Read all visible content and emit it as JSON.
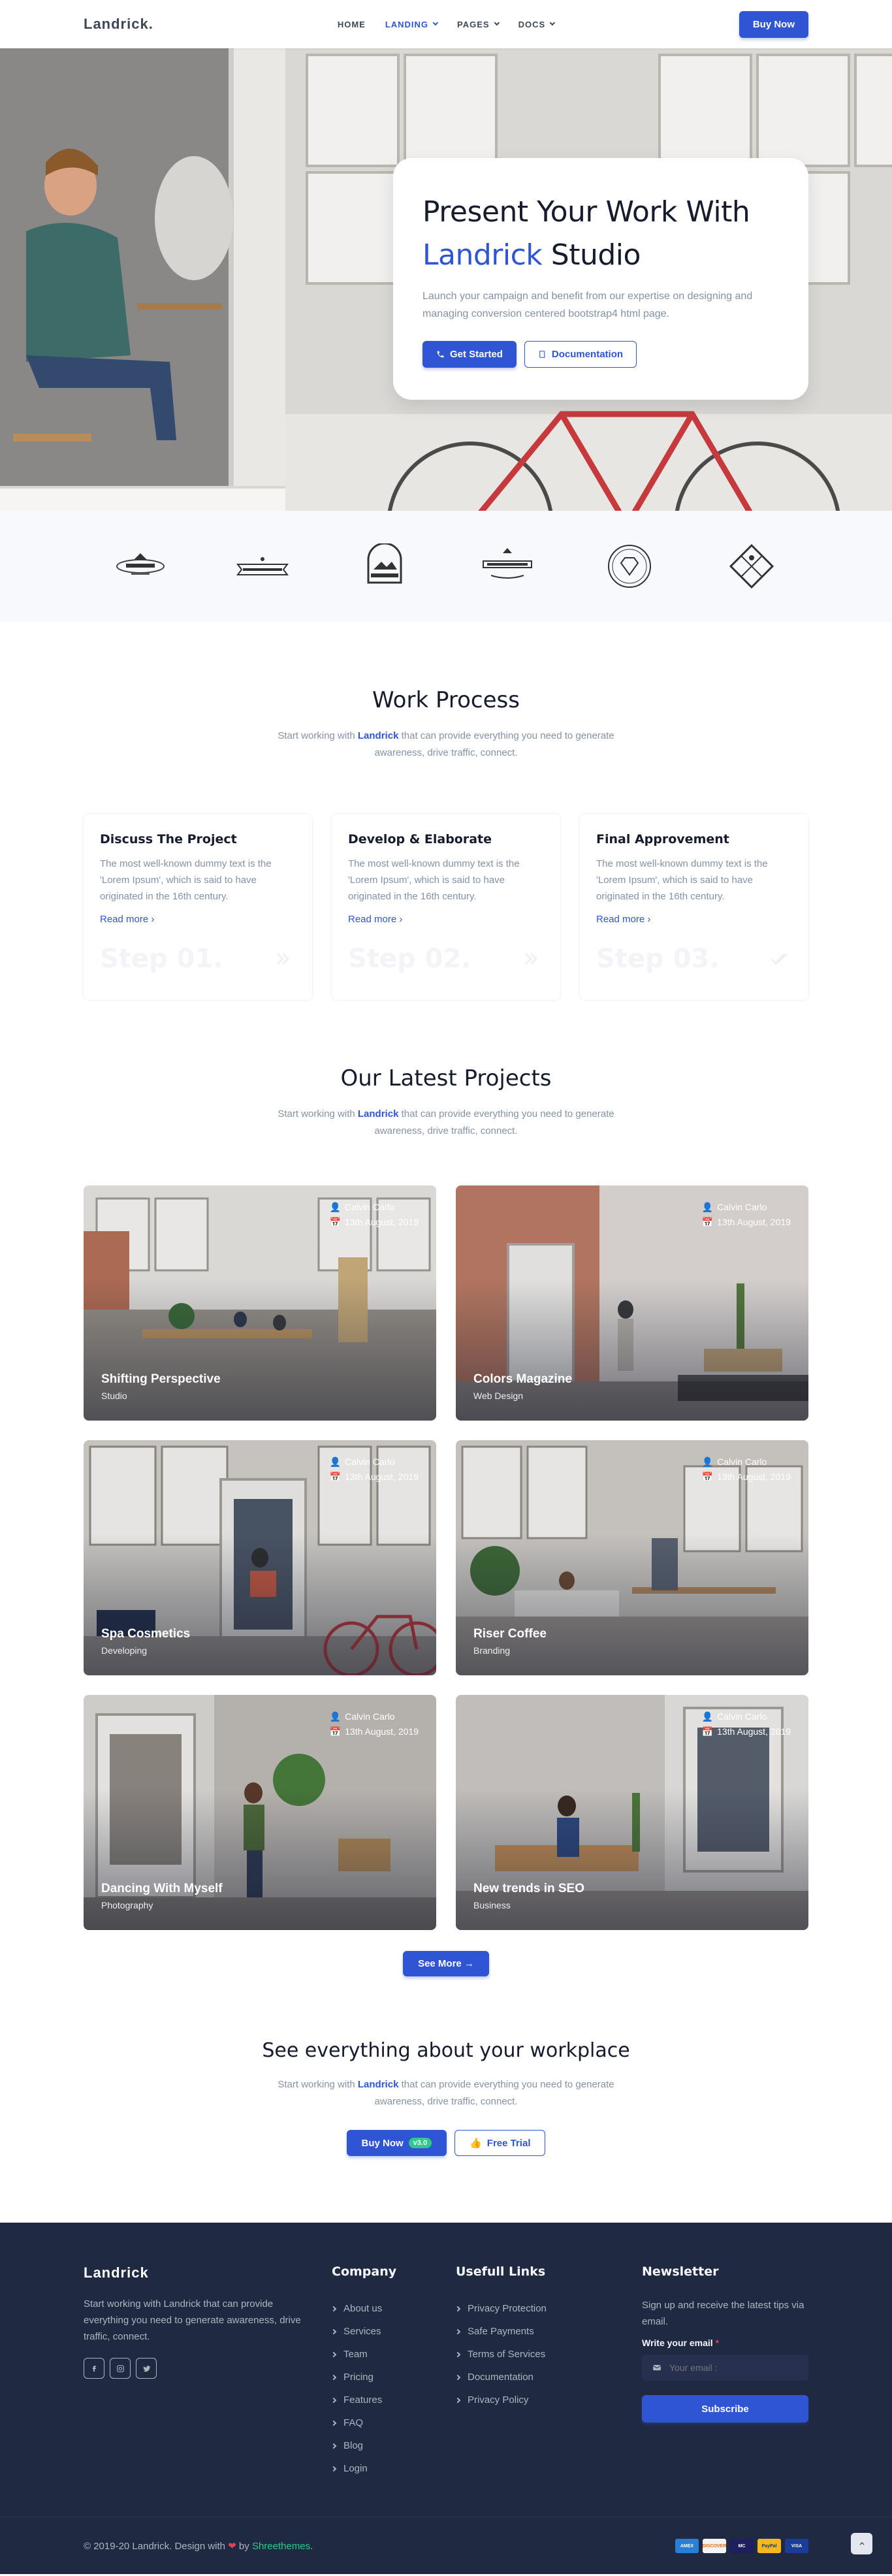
{
  "nav": {
    "logo": "Landrick.",
    "items": [
      {
        "label": "HOME",
        "dropdown": false
      },
      {
        "label": "LANDING",
        "dropdown": true
      },
      {
        "label": "PAGES",
        "dropdown": true
      },
      {
        "label": "DOCS",
        "dropdown": true
      }
    ],
    "buy_label": "Buy Now"
  },
  "hero": {
    "title_line1": "Present Your Work With",
    "title_brand": "Landrick",
    "title_rest": " Studio",
    "subtitle": "Launch your campaign and benefit from our expertise on designing and managing conversion centered bootstrap4 html page.",
    "cta_primary": "Get Started",
    "cta_secondary": "Documentation"
  },
  "clients": [
    "logo-1",
    "logo-2",
    "logo-3",
    "logo-4",
    "logo-5",
    "logo-6"
  ],
  "process": {
    "title": "Work Process",
    "sub_before": "Start working with ",
    "sub_brand": "Landrick",
    "sub_after": " that can provide everything you need to generate awareness, drive traffic, connect.",
    "cards": [
      {
        "title": "Discuss The Project",
        "text": "The most well-known dummy text is the 'Lorem Ipsum', which is said to have originated in the 16th century.",
        "link": "Read more",
        "step": "Step 01.",
        "icon": "chevron-double-right-icon"
      },
      {
        "title": "Develop & Elaborate",
        "text": "The most well-known dummy text is the 'Lorem Ipsum', which is said to have originated in the 16th century.",
        "link": "Read more",
        "step": "Step 02.",
        "icon": "chevron-double-right-icon"
      },
      {
        "title": "Final Approvement",
        "text": "The most well-known dummy text is the 'Lorem Ipsum', which is said to have originated in the 16th century.",
        "link": "Read more",
        "step": "Step 03.",
        "icon": "check-double-icon"
      }
    ]
  },
  "projects": {
    "title": "Our Latest Projects",
    "sub_before": "Start working with ",
    "sub_brand": "Landrick",
    "sub_after": " that can provide everything you need to generate awareness, drive traffic, connect.",
    "items": [
      {
        "title": "Shifting Perspective",
        "category": "Studio",
        "author": "Calvin Carlo",
        "date": "13th August, 2019"
      },
      {
        "title": "Colors Magazine",
        "category": "Web Design",
        "author": "Calvin Carlo",
        "date": "13th August, 2019"
      },
      {
        "title": "Spa Cosmetics",
        "category": "Developing",
        "author": "Calvin Carlo",
        "date": "13th August, 2019"
      },
      {
        "title": "Riser Coffee",
        "category": "Branding",
        "author": "Calvin Carlo",
        "date": "13th August, 2019"
      },
      {
        "title": "Dancing With Myself",
        "category": "Photography",
        "author": "Calvin Carlo",
        "date": "13th August, 2019"
      },
      {
        "title": "New trends in SEO",
        "category": "Business",
        "author": "Calvin Carlo",
        "date": "13th August, 2019"
      }
    ],
    "see_more": "See More"
  },
  "workplace": {
    "title": "See everything about your workplace",
    "sub_before": "Start working with ",
    "sub_brand": "Landrick",
    "sub_after": " that can provide everything you need to generate awareness, drive traffic, connect.",
    "buy_label": "Buy Now",
    "badge": "v3.0",
    "trial_label": "Free Trial"
  },
  "footer": {
    "brand": "Landrick",
    "about": "Start working with Landrick that can provide everything you need to generate awareness, drive traffic, connect.",
    "company_title": "Company",
    "company_links": [
      "About us",
      "Services",
      "Team",
      "Pricing",
      "Features",
      "FAQ",
      "Blog",
      "Login"
    ],
    "useful_title": "Usefull Links",
    "useful_links": [
      "Privacy Protection",
      "Safe Payments",
      "Terms of Services",
      "Documentation",
      "Privacy Policy"
    ],
    "newsletter_title": "Newsletter",
    "newsletter_text": "Sign up and receive the latest tips via email.",
    "email_label": "Write your email",
    "email_required": "*",
    "email_placeholder": "Your email :",
    "subscribe_label": "Subscribe",
    "copyright_before": "© 2019-20 Landrick. Design with ",
    "copyright_heart": "❤",
    "copyright_mid": " by ",
    "copyright_brand": "Shreethemes",
    "copyright_end": ".",
    "payment_cards": [
      "AMEX",
      "DISCOVER",
      "MC",
      "PayPal",
      "VISA"
    ]
  },
  "colors": {
    "primary": "#2f55d4",
    "dark": "#161c2d",
    "muted": "#8492a6",
    "footer_bg": "#202942",
    "success": "#2eca8b"
  }
}
